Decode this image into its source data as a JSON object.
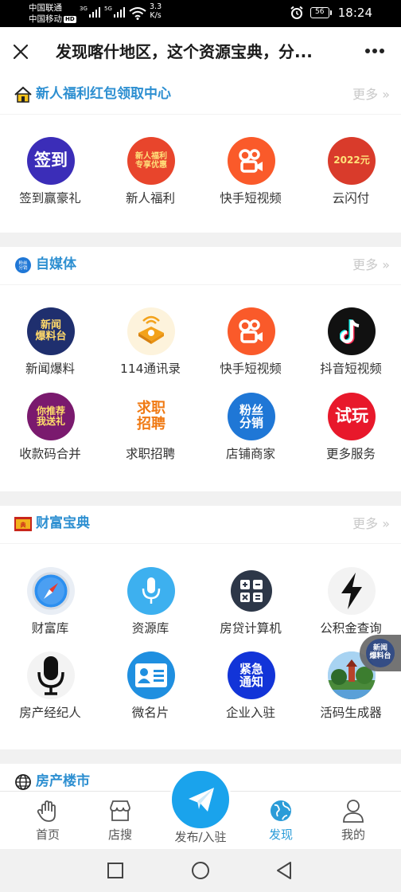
{
  "status_bar": {
    "carrier1": "中国联通",
    "carrier2": "中国移动",
    "hd_badge": "HD",
    "net1": "3G",
    "net2": "5G",
    "speed_value": "3.3",
    "speed_unit": "K/s",
    "battery": "56",
    "time": "18:24"
  },
  "title_bar": {
    "title": "发现喀什地区，这个资源宝典，分..."
  },
  "sections": [
    {
      "title": "新人福利红包领取中心",
      "more": "更多 »",
      "items": [
        {
          "label": "签到赢豪礼",
          "icon": "checkin-icon",
          "color": "#3b2db8",
          "text": "签到"
        },
        {
          "label": "新人福利",
          "icon": "newbie-gift-icon",
          "color": "#e8452c",
          "text": "新人福利\n专享优惠"
        },
        {
          "label": "快手短视频",
          "icon": "kuaishou-icon",
          "color": "#fa5a2a",
          "text": ""
        },
        {
          "label": "云闪付",
          "icon": "unionpay-icon",
          "color": "#d93b2b",
          "text": "2022元"
        }
      ]
    },
    {
      "title": "自媒体",
      "more": "更多 »",
      "items": [
        {
          "label": "新闻爆料",
          "icon": "news-tipoff-icon",
          "color": "#1f2f6e",
          "text": "新闻\n爆料台"
        },
        {
          "label": "114通讯录",
          "icon": "phone-book-icon",
          "color": "#f3a21a",
          "text": ""
        },
        {
          "label": "快手短视频",
          "icon": "kuaishou-icon",
          "color": "#fa5a2a",
          "text": ""
        },
        {
          "label": "抖音短视频",
          "icon": "douyin-icon",
          "color": "#111111",
          "text": ""
        },
        {
          "label": "收款码合并",
          "icon": "payment-code-icon",
          "color": "#7a1a6e",
          "text": "你推荐\n我送礼"
        },
        {
          "label": "求职招聘",
          "icon": "job-icon",
          "color": "#ffffff",
          "text": "求职\n招聘"
        },
        {
          "label": "店铺商家",
          "icon": "fans-distribution-icon",
          "color": "#1f77d6",
          "text": "粉丝\n分销"
        },
        {
          "label": "更多服务",
          "icon": "trial-play-icon",
          "color": "#e8182b",
          "text": "试玩"
        }
      ]
    },
    {
      "title": "财富宝典",
      "more": "更多 »",
      "items": [
        {
          "label": "财富库",
          "icon": "compass-icon",
          "color": "#e9eef5",
          "text": ""
        },
        {
          "label": "资源库",
          "icon": "microphone-icon",
          "color": "#3db0ef",
          "text": ""
        },
        {
          "label": "房贷计算机",
          "icon": "calculator-icon",
          "color": "#ffffff",
          "text": ""
        },
        {
          "label": "公积金查询",
          "icon": "lightning-icon",
          "color": "#ffffff",
          "text": ""
        },
        {
          "label": "房产经纪人",
          "icon": "mic-icon",
          "color": "#ffffff",
          "text": ""
        },
        {
          "label": "微名片",
          "icon": "business-card-icon",
          "color": "#1f8fe0",
          "text": ""
        },
        {
          "label": "企业入驻",
          "icon": "notice-icon",
          "color": "#1234d8",
          "text": "紧急\n通知"
        },
        {
          "label": "活码生成器",
          "icon": "scenery-icon",
          "color": "#4a8a3a",
          "text": ""
        }
      ]
    },
    {
      "title": "房产楼市",
      "more": "",
      "items": []
    }
  ],
  "float_bubble": {
    "text": "新闻\n爆料台"
  },
  "bottom_nav": [
    {
      "label": "首页",
      "icon": "palm-hand-icon"
    },
    {
      "label": "店搜",
      "icon": "store-icon"
    },
    {
      "label": "发布/入驻",
      "icon": "paper-plane-icon"
    },
    {
      "label": "发现",
      "icon": "globe-icon",
      "active": true
    },
    {
      "label": "我的",
      "icon": "user-icon"
    }
  ],
  "colors": {
    "accent": "#2d8fd1",
    "active_nav": "#2b9cd8",
    "publish": "#1aa3ec",
    "more_text": "#c9c9c9"
  }
}
